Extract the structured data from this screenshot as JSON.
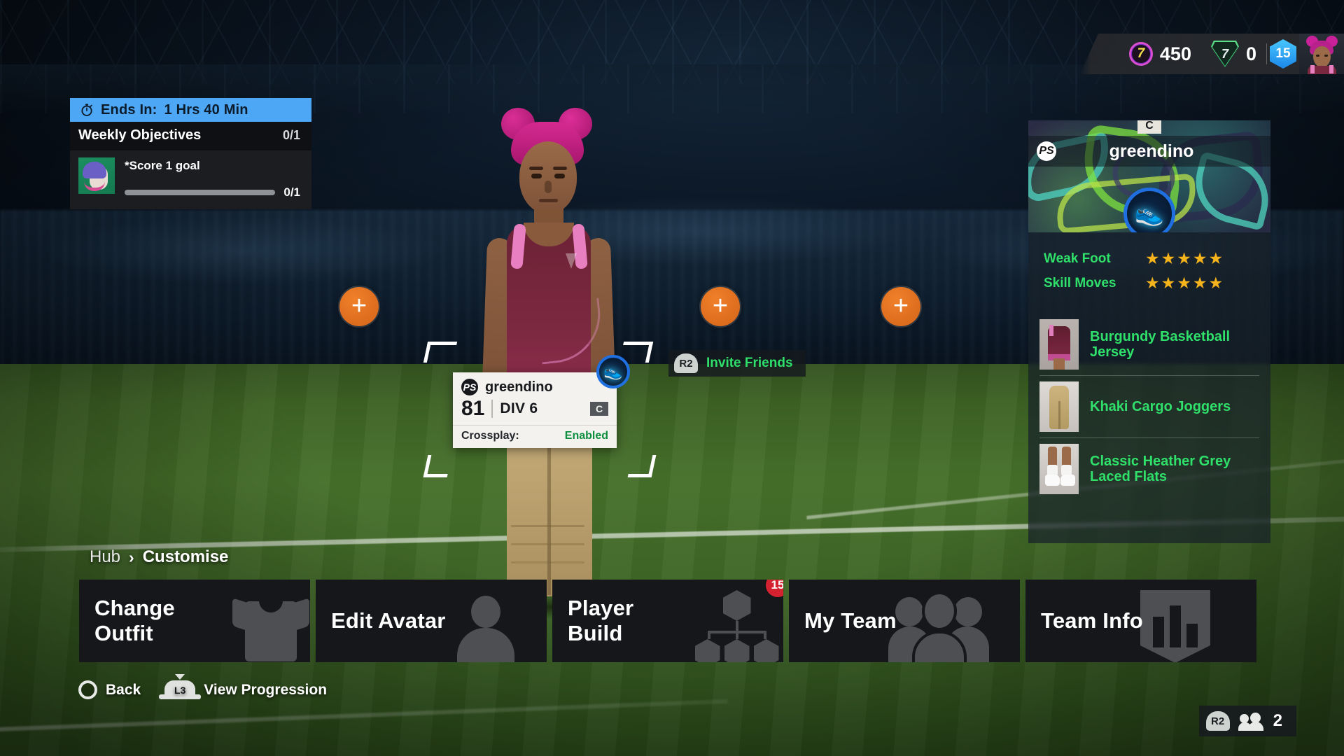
{
  "objectives": {
    "timer_icon": "stopwatch-icon",
    "timer_prefix": "Ends In:",
    "timer_value": "1 Hrs 40 Min",
    "section_title": "Weekly Objectives",
    "section_count": "0/1",
    "items": [
      {
        "text": "*Score 1 goal",
        "progress_label": "0/1",
        "progress_percent": 0,
        "thumb": "goalkeeper-avatar-thumb"
      }
    ]
  },
  "top_hud": {
    "currency": {
      "icon": "coin-icon",
      "value": "450"
    },
    "vp": {
      "icon": "vp-icon",
      "value": "0"
    },
    "level": {
      "icon": "level-hex-icon",
      "value": "15"
    },
    "avatar": "player-avatar-thumb"
  },
  "player_panel": {
    "captain_badge": "C",
    "platform_icon": "playstation-icon",
    "username": "greendino",
    "emblem_icon": "running-shoe-icon",
    "stats": [
      {
        "label": "Weak Foot",
        "stars": "★★★★★",
        "value": 5
      },
      {
        "label": "Skill Moves",
        "stars": "★★★★★",
        "value": 5
      }
    ],
    "equipped_items": [
      {
        "name": "Burgundy Basketball Jersey",
        "thumb": "jersey-thumb"
      },
      {
        "name": "Khaki Cargo Joggers",
        "thumb": "joggers-thumb"
      },
      {
        "name": "Classic Heather Grey Laced Flats",
        "thumb": "shoes-thumb"
      }
    ]
  },
  "add_slots": [
    {
      "label": "+",
      "name": "add-player-slot-1"
    },
    {
      "label": "+",
      "name": "add-player-slot-2"
    },
    {
      "label": "+",
      "name": "add-player-slot-3"
    }
  ],
  "invite": {
    "button_hint": "R2",
    "label": "Invite Friends"
  },
  "nameplate": {
    "platform_icon": "playstation-icon",
    "username": "greendino",
    "overall": "81",
    "division": "DIV 6",
    "captain_badge": "C",
    "crossplay_label": "Crossplay:",
    "crossplay_value": "Enabled",
    "emblem_icon": "running-shoe-icon"
  },
  "breadcrumb": {
    "root": "Hub",
    "separator": "›",
    "current": "Customise"
  },
  "menu_tiles": [
    {
      "label": "Change Outfit",
      "art": "shirt-icon",
      "badge": null
    },
    {
      "label": "Edit Avatar",
      "art": "person-icon",
      "badge": null
    },
    {
      "label": "Player Build",
      "art": "skill-tree-icon",
      "badge": "15"
    },
    {
      "label": "My Team",
      "art": "group-icon",
      "badge": null
    },
    {
      "label": "Team Info",
      "art": "bar-chart-icon",
      "badge": null
    }
  ],
  "footer_prompts": [
    {
      "button": "circle-button-icon",
      "label": "Back"
    },
    {
      "button": "L3",
      "label": "View Progression"
    }
  ],
  "player_count": {
    "button_hint": "R2",
    "icon": "people-icon",
    "count": "2"
  },
  "colors": {
    "timer_bg": "#4ea7f5",
    "accent_green": "#2fe06a",
    "star_gold": "#f5b31c",
    "badge_red": "#d52231",
    "add_orange": "#e0711f",
    "tile_bg": "#15171a"
  }
}
